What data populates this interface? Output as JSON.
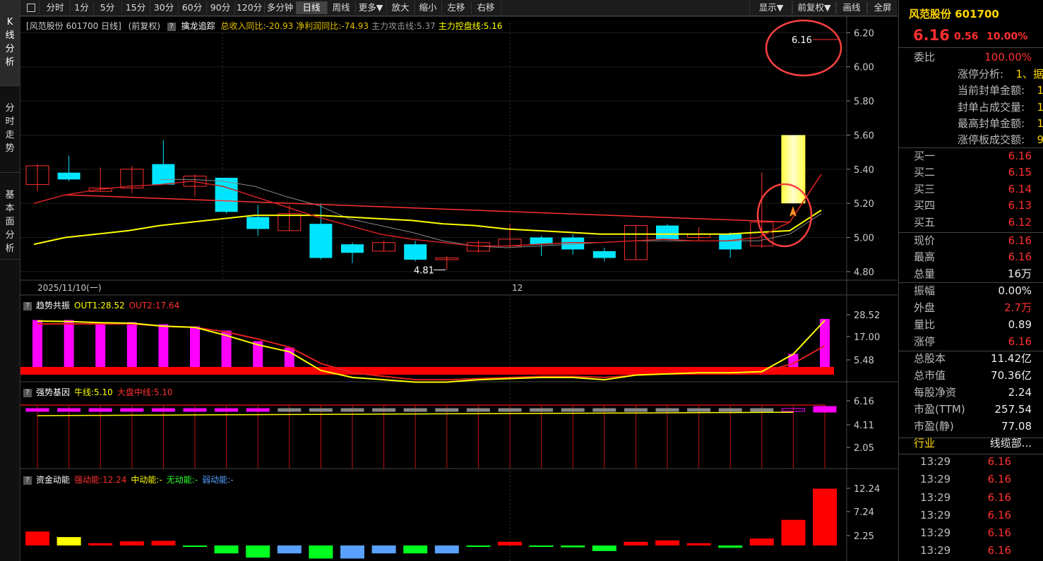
{
  "toolbar": {
    "periods": [
      "分时",
      "1分",
      "5分",
      "15分",
      "30分",
      "60分",
      "90分",
      "120分",
      "多分钟",
      "日线",
      "周线",
      "更多▼",
      "放大",
      "缩小",
      "左移",
      "右移"
    ],
    "right_buttons": [
      "显示▼",
      "前复权▼",
      "画线",
      "全屏"
    ]
  },
  "left_tabs": [
    "K线分析",
    "分时走势",
    "基本面分析"
  ],
  "main_panel": {
    "title": "[风范股份 601700 日线]",
    "adjust": "(前复权)",
    "indicator": "擒龙追踪",
    "items": [
      {
        "label": "总收入同比:-20.93",
        "color": "#e0c000"
      },
      {
        "label": "净利润同比:-74.93",
        "color": "#e0c000"
      },
      {
        "label": "主力攻击线:5.37",
        "color": "#999999"
      },
      {
        "label": "主力控盘线:5.16",
        "color": "#ffff00"
      }
    ],
    "price_ticks": [
      "6.20",
      "6.00",
      "5.80",
      "5.60",
      "5.40",
      "5.20",
      "5.00",
      "4.80"
    ],
    "date_label": "2025/11/10(一)",
    "month_label": "12",
    "max_label": "6.16",
    "min_label": "4.81"
  },
  "panel_trend": {
    "name": "趋势共振",
    "items": [
      {
        "label": "OUT1:28.52",
        "color": "#ffff00"
      },
      {
        "label": "OUT2:17.64",
        "color": "#ff3030"
      }
    ],
    "ticks": [
      "28.52",
      "17.00",
      "5.48"
    ]
  },
  "panel_strong": {
    "name": "强势基因",
    "items": [
      {
        "label": "牛线:5.10",
        "color": "#ffff00"
      },
      {
        "label": "大盘中线:5.10",
        "color": "#ff3030"
      }
    ],
    "ticks": [
      "6.16",
      "4.11",
      "2.05"
    ]
  },
  "panel_fund": {
    "name": "资金动能",
    "items": [
      {
        "label": "强动能:12.24",
        "color": "#ff3030"
      },
      {
        "label": "中动能:-",
        "color": "#ffff00"
      },
      {
        "label": "无动能:-",
        "color": "#30ff30"
      },
      {
        "label": "弱动能:-",
        "color": "#5aa0ff"
      }
    ],
    "ticks": [
      "12.24",
      "7.24",
      "2.25"
    ]
  },
  "chart_data": {
    "type": "candlestick",
    "price_range": [
      4.75,
      6.28
    ],
    "candles": [
      {
        "o": 5.31,
        "h": 5.43,
        "l": 5.27,
        "c": 5.42
      },
      {
        "o": 5.38,
        "h": 5.48,
        "l": 5.33,
        "c": 5.34
      },
      {
        "o": 5.27,
        "h": 5.41,
        "l": 5.27,
        "c": 5.29
      },
      {
        "o": 5.29,
        "h": 5.42,
        "l": 5.26,
        "c": 5.4
      },
      {
        "o": 5.43,
        "h": 5.57,
        "l": 5.31,
        "c": 5.31
      },
      {
        "o": 5.3,
        "h": 5.37,
        "l": 5.24,
        "c": 5.36
      },
      {
        "o": 5.35,
        "h": 5.35,
        "l": 5.14,
        "c": 5.15
      },
      {
        "o": 5.12,
        "h": 5.19,
        "l": 5.01,
        "c": 5.05
      },
      {
        "o": 5.04,
        "h": 5.19,
        "l": 5.04,
        "c": 5.14
      },
      {
        "o": 5.08,
        "h": 5.2,
        "l": 4.87,
        "c": 4.88
      },
      {
        "o": 4.96,
        "h": 4.97,
        "l": 4.85,
        "c": 4.91
      },
      {
        "o": 4.92,
        "h": 4.98,
        "l": 4.92,
        "c": 4.97
      },
      {
        "o": 4.96,
        "h": 4.98,
        "l": 4.86,
        "c": 4.87
      },
      {
        "o": 4.87,
        "h": 4.89,
        "l": 4.81,
        "c": 4.88
      },
      {
        "o": 4.92,
        "h": 4.98,
        "l": 4.91,
        "c": 4.97
      },
      {
        "o": 4.95,
        "h": 5.08,
        "l": 4.94,
        "c": 4.99
      },
      {
        "o": 5.0,
        "h": 5.01,
        "l": 4.89,
        "c": 4.96
      },
      {
        "o": 5.0,
        "h": 5.02,
        "l": 4.9,
        "c": 4.93
      },
      {
        "o": 4.92,
        "h": 4.94,
        "l": 4.86,
        "c": 4.88
      },
      {
        "o": 4.87,
        "h": 5.07,
        "l": 4.87,
        "c": 5.07
      },
      {
        "o": 5.07,
        "h": 5.08,
        "l": 4.99,
        "c": 4.99
      },
      {
        "o": 5.0,
        "h": 5.06,
        "l": 4.98,
        "c": 5.02
      },
      {
        "o": 5.02,
        "h": 5.03,
        "l": 4.88,
        "c": 4.93
      },
      {
        "o": 4.95,
        "h": 5.38,
        "l": 4.94,
        "c": 5.09
      },
      {
        "o": 5.6,
        "h": 5.6,
        "l": 5.2,
        "c": 5.2
      }
    ],
    "ma_gray": [
      null,
      null,
      null,
      null,
      5.34,
      5.34,
      5.33,
      5.3,
      5.24,
      5.19,
      5.11,
      5.07,
      5.03,
      4.98,
      4.95,
      4.94,
      4.95,
      4.96,
      4.97,
      4.98,
      4.98,
      4.98,
      4.98,
      4.98,
      5.02,
      5.14
    ],
    "ma_yellow": [
      4.96,
      5.0,
      5.02,
      5.04,
      5.07,
      5.09,
      5.11,
      5.13,
      5.13,
      5.13,
      5.12,
      5.11,
      5.1,
      5.08,
      5.07,
      5.05,
      5.04,
      5.03,
      5.02,
      5.02,
      5.02,
      5.02,
      5.02,
      5.03,
      5.04,
      5.16
    ],
    "ma_red": [
      5.2,
      5.25,
      5.28,
      5.3,
      5.31,
      5.33,
      5.3,
      5.24,
      5.18,
      5.12,
      5.07,
      5.02,
      4.99,
      4.97,
      4.95,
      4.95,
      4.96,
      4.97,
      4.97,
      4.98,
      4.99,
      4.98,
      4.98,
      5.0,
      5.09,
      5.37
    ]
  }
}
